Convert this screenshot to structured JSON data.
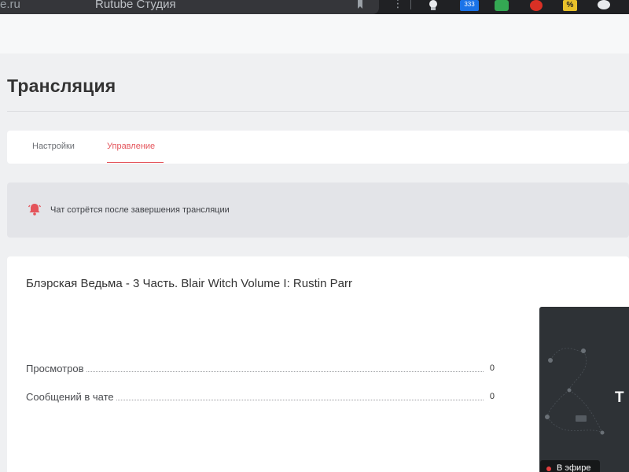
{
  "browser": {
    "url_fragment": "e.ru",
    "tab_title": "Rutube Студия",
    "extensions": {
      "calendar_badge": "333",
      "percent_badge": "%"
    }
  },
  "page": {
    "title": "Трансляция",
    "tabs": [
      {
        "label": "Настройки",
        "active": false
      },
      {
        "label": "Управление",
        "active": true
      }
    ],
    "notice": {
      "text": "Чат сотрётся после завершения трансляции",
      "icon": "bell-icon"
    },
    "stream": {
      "title": "Блэрская Ведьма - 3 Часть. Blair Witch Volume I: Rustin Parr",
      "stats": [
        {
          "label": "Просмотров",
          "value": "0"
        },
        {
          "label": "Сообщений в чате",
          "value": "0"
        }
      ],
      "preview": {
        "letter": "T",
        "live_label": "В эфире"
      }
    }
  },
  "colors": {
    "accent": "#e4545b",
    "background": "#eff0f2",
    "chrome": "#202124"
  }
}
